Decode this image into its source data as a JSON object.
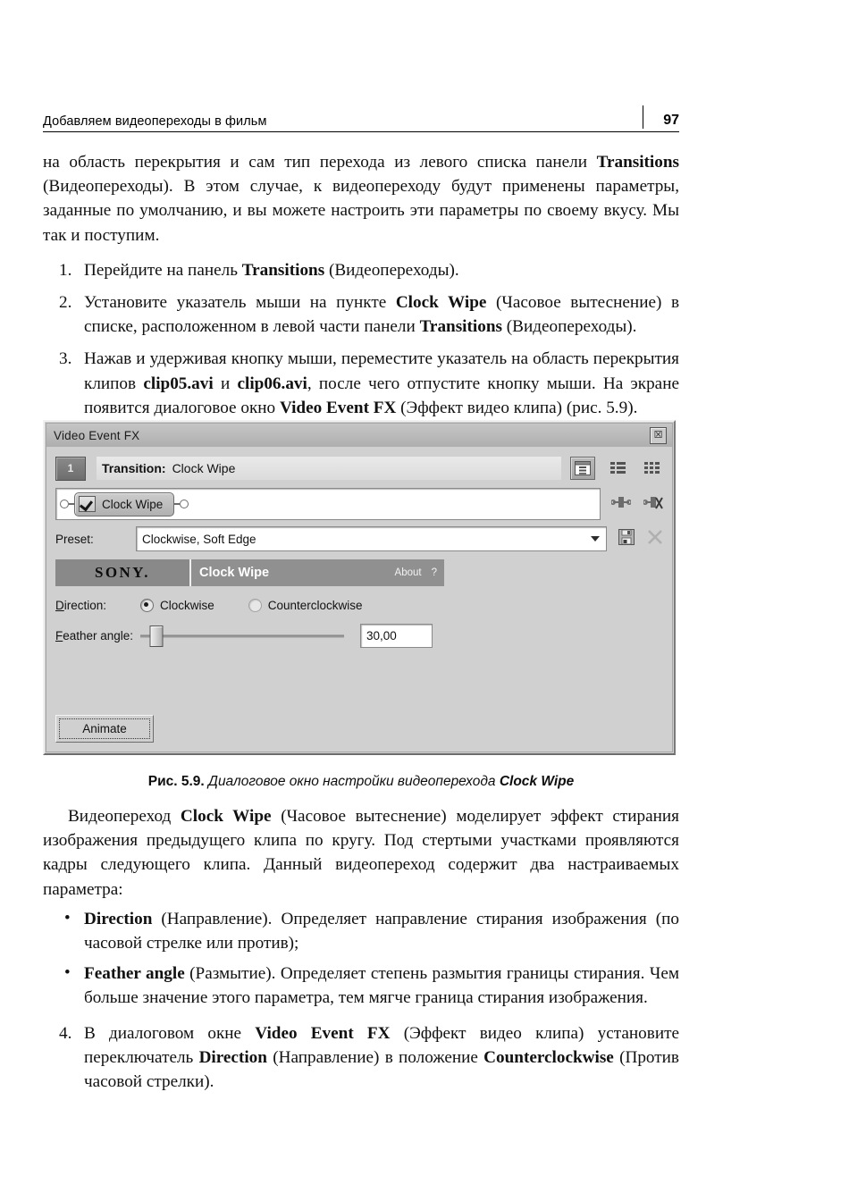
{
  "runhead": {
    "title": "Добавляем видеопереходы в фильм",
    "page_number": "97"
  },
  "intro": {
    "paragraph_1a": "на область перекрытия и сам тип перехода из левого списка панели ",
    "paragraph_1b": "Transitions",
    "paragraph_1c": " (Видеопереходы). В этом случае, к видеопереходу будут применены параметры, заданные по умолчанию, и вы можете настроить эти параметры по своему вкусу. Мы так и поступим."
  },
  "steps": [
    {
      "num": "1.",
      "parts": [
        {
          "t": "Перейдите на панель ",
          "b": false
        },
        {
          "t": "Transitions",
          "b": true
        },
        {
          "t": " (Видеопереходы).",
          "b": false
        }
      ]
    },
    {
      "num": "2.",
      "parts": [
        {
          "t": "Установите указатель мыши на пункте ",
          "b": false
        },
        {
          "t": "Clock Wipe",
          "b": true
        },
        {
          "t": " (Часовое вытеснение) в списке, расположенном в левой части панели ",
          "b": false
        },
        {
          "t": "Transitions",
          "b": true
        },
        {
          "t": " (Видеопереходы).",
          "b": false
        }
      ]
    },
    {
      "num": "3.",
      "parts": [
        {
          "t": "Нажав и удерживая кнопку мыши, переместите указатель на область перекрытия клипов ",
          "b": false
        },
        {
          "t": "clip05.avi",
          "b": true
        },
        {
          "t": " и ",
          "b": false
        },
        {
          "t": "clip06.avi",
          "b": true
        },
        {
          "t": ", после чего отпустите кнопку мыши. На экране появится диалоговое окно ",
          "b": false
        },
        {
          "t": "Video Event FX",
          "b": true
        },
        {
          "t": " (Эффект видео клипа) (рис. 5.9).",
          "b": false
        }
      ]
    }
  ],
  "dialog": {
    "title": "Video Event FX",
    "close_icon": "close-box-icon",
    "channel_badge": "1",
    "transition_key": "Transition:",
    "transition_value": "Clock Wipe",
    "view_icons": [
      {
        "name": "plugin-view-icon",
        "selected": true
      },
      {
        "name": "list-view-icon",
        "selected": false
      },
      {
        "name": "grid-view-icon",
        "selected": false
      }
    ],
    "chain": {
      "node_label": "Clock Wipe",
      "node_checked": true,
      "tools": [
        {
          "name": "add-plugin-icon"
        },
        {
          "name": "remove-plugin-icon"
        }
      ]
    },
    "preset": {
      "label": "Preset:",
      "value": "Clockwise, Soft Edge",
      "dropdown_icon": "chevron-down-icon",
      "tools": [
        {
          "name": "save-preset-icon"
        },
        {
          "name": "delete-preset-icon"
        }
      ]
    },
    "banner": {
      "brand": "SONY.",
      "effect_name": "Clock Wipe",
      "about_label": "About",
      "help_label": "?"
    },
    "direction": {
      "label": "Direction:",
      "options": [
        {
          "label": "Clockwise",
          "selected": true
        },
        {
          "label": "Counterclockwise",
          "selected": false
        }
      ]
    },
    "feather": {
      "label": "Feather angle:",
      "value": "30,00",
      "slider_percent": 8
    },
    "animate_button": "Animate"
  },
  "figure": {
    "caption_lead": "Рис. 5.9.",
    "caption_text": " Диалоговое окно настройки видеоперехода ",
    "caption_bold": "Clock Wipe"
  },
  "after": {
    "p1_parts": [
      {
        "t": "Видеопереход ",
        "b": false
      },
      {
        "t": "Clock Wipe",
        "b": true
      },
      {
        "t": " (Часовое вытеснение) моделирует эффект стирания изображения предыдущего клипа по кругу. Под стертыми участками проявляются кадры следующего клипа. Данный видеопереход содержит два настраиваемых параметра:",
        "b": false
      }
    ],
    "bullets": [
      {
        "dot": "•",
        "parts": [
          {
            "t": "Direction",
            "b": true
          },
          {
            "t": " (Направление). Определяет направление стирания изображения (по часовой стрелке или против);",
            "b": false
          }
        ]
      },
      {
        "dot": "•",
        "parts": [
          {
            "t": "Feather angle",
            "b": true
          },
          {
            "t": " (Размытие). Определяет степень размытия границы стирания. Чем больше значение этого параметра, тем мягче граница стирания изображения.",
            "b": false
          }
        ]
      }
    ],
    "step4": {
      "num": "4.",
      "parts": [
        {
          "t": "В диалоговом окне ",
          "b": false
        },
        {
          "t": "Video Event FX",
          "b": true
        },
        {
          "t": " (Эффект видео клипа) установите переключатель ",
          "b": false
        },
        {
          "t": "Direction",
          "b": true
        },
        {
          "t": " (Направление) в положение ",
          "b": false
        },
        {
          "t": "Counterclockwise",
          "b": true
        },
        {
          "t": " (Против часовой стрелки).",
          "b": false
        }
      ]
    }
  }
}
